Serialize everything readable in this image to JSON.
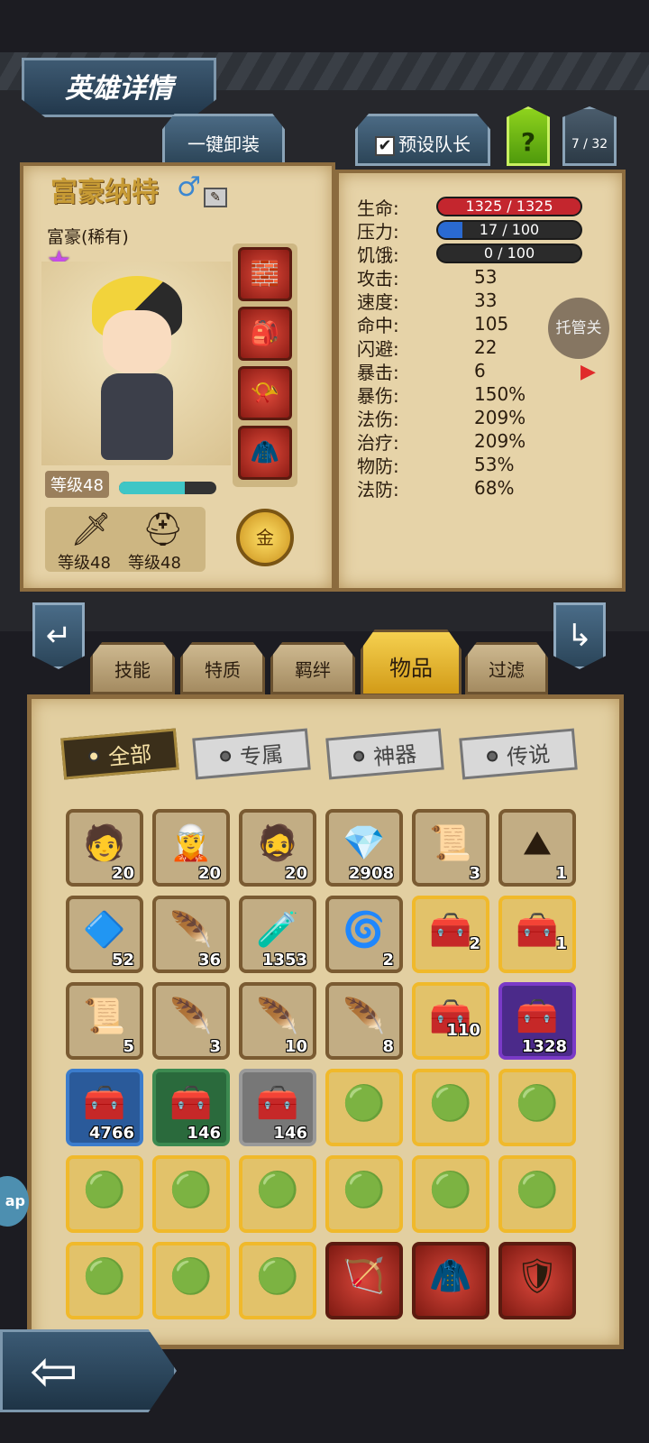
{
  "header": {
    "title": "英雄详情",
    "unequip_label": "一键卸装",
    "captain_label": "预设队长",
    "captain_checked": "✔",
    "help_label": "?",
    "hero_count": "7 / 32"
  },
  "hero": {
    "name": "富豪纳特",
    "gender": "♂",
    "class": "富豪(稀有)",
    "star": "★",
    "level_label": "等级48",
    "xp_fraction": 0.68,
    "weapon_level": "等级48",
    "armor_level": "等级48",
    "gold_label": "金"
  },
  "stats": {
    "hp_label": "生命:",
    "hp_value": "1325 / 1325",
    "hp_fraction": 1.0,
    "stress_label": "压力:",
    "stress_value": "17 / 100",
    "stress_fraction": 0.17,
    "hunger_label": "饥饿:",
    "hunger_value": "0 / 100",
    "hunger_fraction": 0.0,
    "rows": [
      {
        "label": "攻击:",
        "value": "53"
      },
      {
        "label": "速度:",
        "value": "33"
      },
      {
        "label": "命中:",
        "value": "105"
      },
      {
        "label": "闪避:",
        "value": "22"
      },
      {
        "label": "暴击:",
        "value": "6"
      },
      {
        "label": "暴伤:",
        "value": "150%"
      },
      {
        "label": "法伤:",
        "value": "209%"
      },
      {
        "label": "治疗:",
        "value": "209%"
      },
      {
        "label": "物防:",
        "value": "53%"
      },
      {
        "label": "法防:",
        "value": "68%"
      }
    ],
    "auto_label": "托管关"
  },
  "tabs": [
    "技能",
    "特质",
    "羁绊",
    "物品",
    "过滤"
  ],
  "active_tab": "物品",
  "filters": [
    "全部",
    "专属",
    "神器",
    "传说"
  ],
  "items": [
    {
      "icon": "🧑",
      "qty": "20"
    },
    {
      "icon": "🧝",
      "qty": "20"
    },
    {
      "icon": "🧔",
      "qty": "20"
    },
    {
      "icon": "💎",
      "qty": "2908"
    },
    {
      "icon": "📜",
      "qty": "3"
    },
    {
      "icon": "⛰",
      "qty": "1"
    },
    {
      "icon": "🔷",
      "qty": "52"
    },
    {
      "icon": "🪶",
      "qty": "36"
    },
    {
      "icon": "🧪",
      "qty": "1353"
    },
    {
      "icon": "🌀",
      "qty": "2"
    },
    {
      "icon": "🧰",
      "qty": "2"
    },
    {
      "icon": "🧰",
      "qty": "1"
    },
    {
      "icon": "📜",
      "qty": "5"
    },
    {
      "icon": "🪶",
      "qty": "3"
    },
    {
      "icon": "🪶",
      "qty": "10"
    },
    {
      "icon": "🪶",
      "qty": "8"
    },
    {
      "icon": "🧰",
      "qty": "110"
    },
    {
      "icon": "🧰",
      "qty": "1328"
    },
    {
      "icon": "🧰",
      "qty": "4766"
    },
    {
      "icon": "🧰",
      "qty": "146"
    },
    {
      "icon": "🧰",
      "qty": "146"
    },
    {
      "icon": "🟢",
      "qty": ""
    },
    {
      "icon": "🟢",
      "qty": ""
    },
    {
      "icon": "🟢",
      "qty": ""
    },
    {
      "icon": "🟢",
      "qty": ""
    },
    {
      "icon": "🟢",
      "qty": ""
    },
    {
      "icon": "🟢",
      "qty": ""
    },
    {
      "icon": "🟢",
      "qty": ""
    },
    {
      "icon": "🟢",
      "qty": ""
    },
    {
      "icon": "🟢",
      "qty": ""
    },
    {
      "icon": "🟢",
      "qty": ""
    },
    {
      "icon": "🟢",
      "qty": ""
    },
    {
      "icon": "🟢",
      "qty": ""
    },
    {
      "icon": "🏹",
      "qty": ""
    },
    {
      "icon": "🧥",
      "qty": ""
    },
    {
      "icon": "🛡",
      "qty": ""
    }
  ],
  "side_bubble": "ap",
  "back_arrow": "⇦"
}
